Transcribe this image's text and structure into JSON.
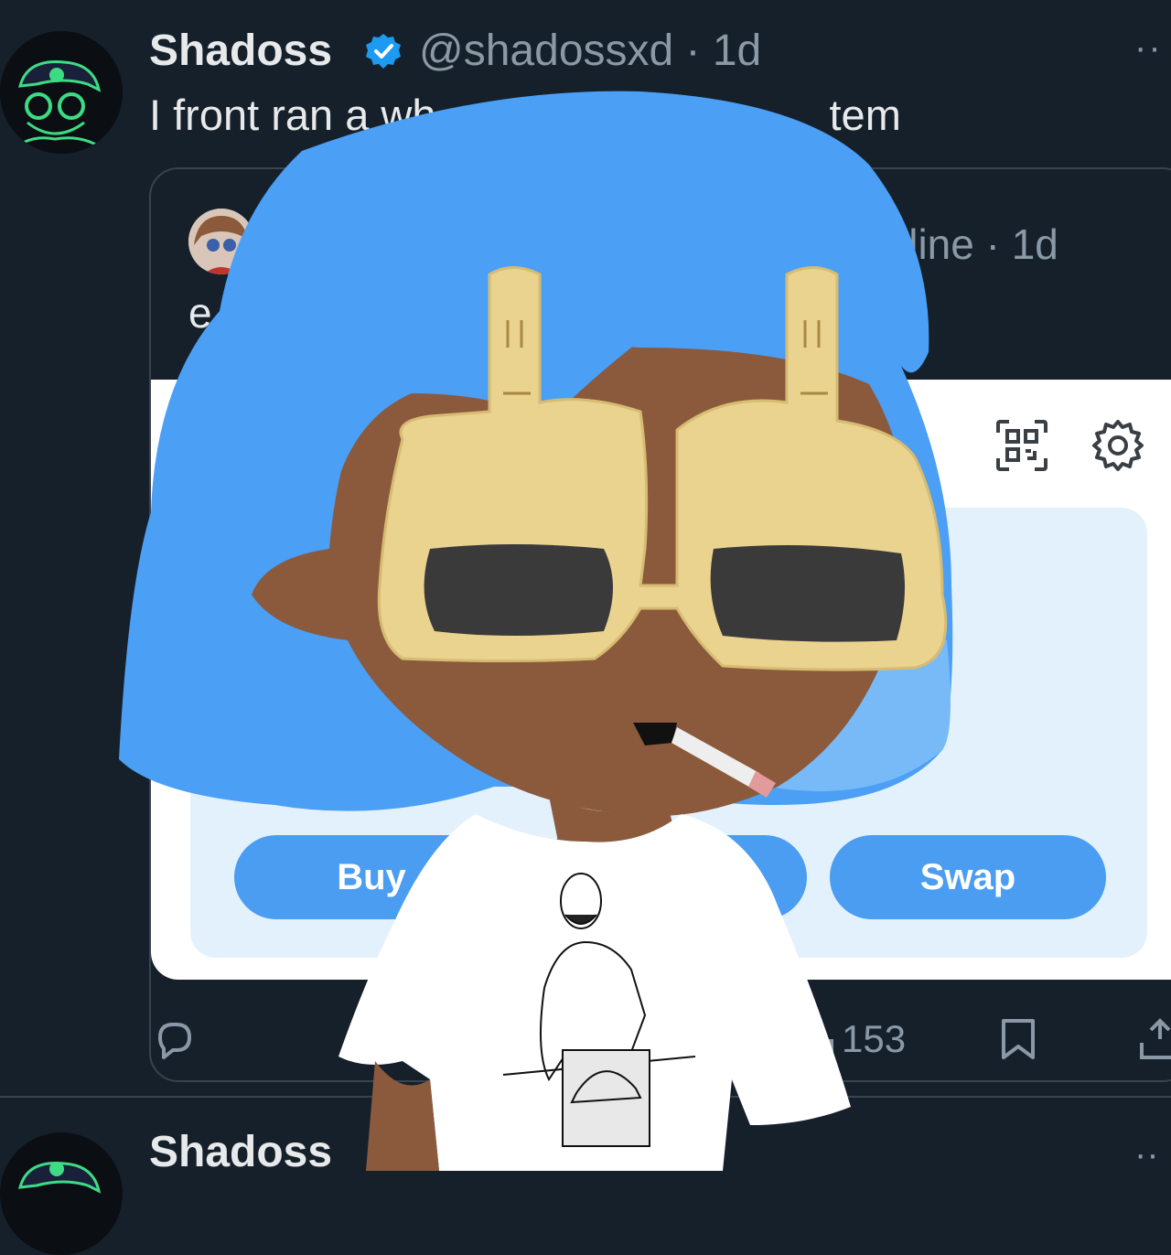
{
  "tweet": {
    "author_name": "Shadoss",
    "handle_time": "@shadossxd · 1d",
    "more_label": "··",
    "text": "I front ran a wh",
    "text_tail": "tem"
  },
  "quote": {
    "handle_time": "wline · 1d",
    "text": "e"
  },
  "widget": {
    "buy_label": "Buy",
    "swap_label": "Swap"
  },
  "actions": {
    "views_count": "153"
  },
  "next_tweet": {
    "author_name": "Shadoss"
  },
  "colors": {
    "background": "#15202b",
    "accent": "#4a9df0",
    "verified": "#1d9bf0",
    "hair": "#4b9ff5",
    "skin": "#8b5a3c"
  },
  "icons": [
    "verified-badge-icon",
    "more-icon",
    "qr-code-icon",
    "settings-icon",
    "reply-icon",
    "bookmark-icon",
    "share-icon"
  ]
}
